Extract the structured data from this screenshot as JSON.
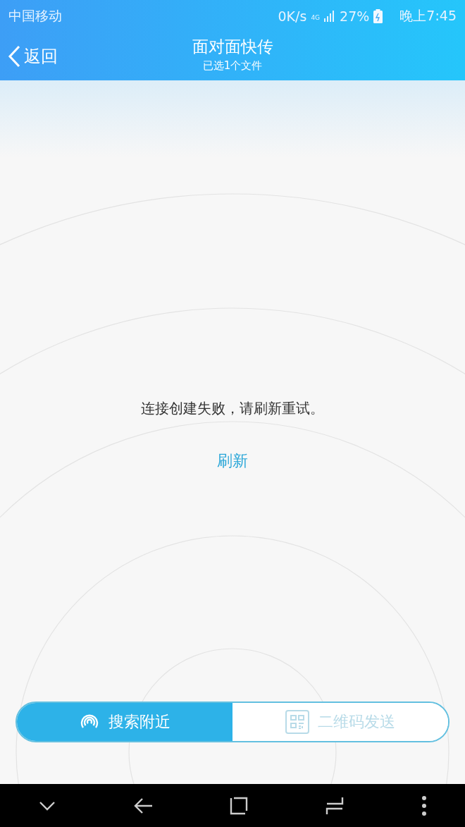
{
  "status_bar": {
    "carrier": "中国移动",
    "speed": "0K/s",
    "network": "4G",
    "battery": "27%",
    "time": "晚上7:45"
  },
  "header": {
    "back": "返回",
    "title": "面对面快传",
    "subtitle": "已选1个文件"
  },
  "message": "连接创建失败，请刷新重试。",
  "refresh": "刷新",
  "modes": [
    {
      "kind": "nearby",
      "label": "搜索附近",
      "selected": true
    },
    {
      "kind": "qrcode",
      "label": "二维码发送",
      "selected": false
    }
  ]
}
